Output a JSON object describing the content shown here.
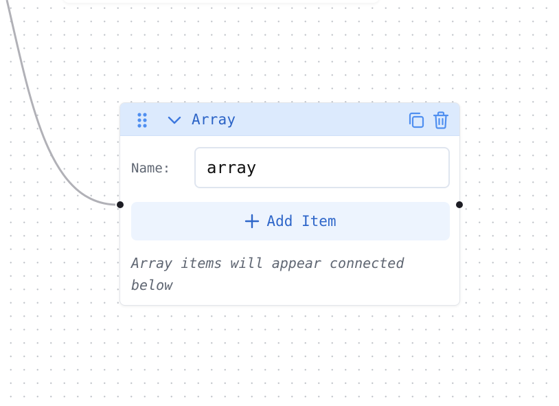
{
  "node": {
    "title": "Array",
    "name_label": "Name:",
    "name_value": "array",
    "add_item_label": "Add Item",
    "hint": "Array items will appear connected below"
  },
  "icons": {
    "drag": "drag-handle-icon",
    "collapse": "chevron-down-icon",
    "copy": "copy-icon",
    "delete": "trash-icon",
    "add": "plus-icon"
  },
  "colors": {
    "header_bg": "#dceafd",
    "accent": "#2b63c6",
    "edge": "#b1b1b7",
    "handle": "#1d1d24"
  }
}
